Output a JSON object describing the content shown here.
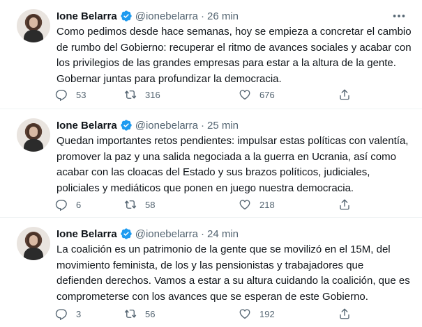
{
  "tweets": [
    {
      "name": "Ione Belarra",
      "handle": "@ionebelarra",
      "time": "26 min",
      "text": "Como pedimos desde hace semanas, hoy se empieza a concretar el cambio de rumbo del Gobierno: recuperar el ritmo de avances sociales y acabar con los privilegios de las grandes empresas para estar a la altura de la gente. Gobernar juntas para profundizar la democracia.",
      "replies": "53",
      "retweets": "316",
      "likes": "676"
    },
    {
      "name": "Ione Belarra",
      "handle": "@ionebelarra",
      "time": "25 min",
      "text": "Quedan importantes retos pendientes: impulsar estas políticas con valentía, promover la paz y una salida negociada a la guerra en Ucrania, así como acabar con las cloacas del Estado y sus brazos políticos, judiciales, policiales y mediáticos que ponen en juego nuestra democracia.",
      "replies": "6",
      "retweets": "58",
      "likes": "218"
    },
    {
      "name": "Ione Belarra",
      "handle": "@ionebelarra",
      "time": "24 min",
      "text": "La coalición es un patrimonio de la gente que se movilizó en el 15M, del movimiento feminista, de los y las pensionistas y trabajadores que defienden derechos. Vamos a estar a su altura cuidando la coalición, que es comprometerse con los avances que se esperan de este Gobierno.",
      "replies": "3",
      "retweets": "56",
      "likes": "192"
    }
  ],
  "separator": "·",
  "colors": {
    "verified": "#1d9bf0",
    "secondary_text": "#536471",
    "primary_text": "#0f1419"
  },
  "icons": [
    "verified-badge-icon",
    "more-icon",
    "reply-icon",
    "retweet-icon",
    "like-icon",
    "share-icon"
  ]
}
